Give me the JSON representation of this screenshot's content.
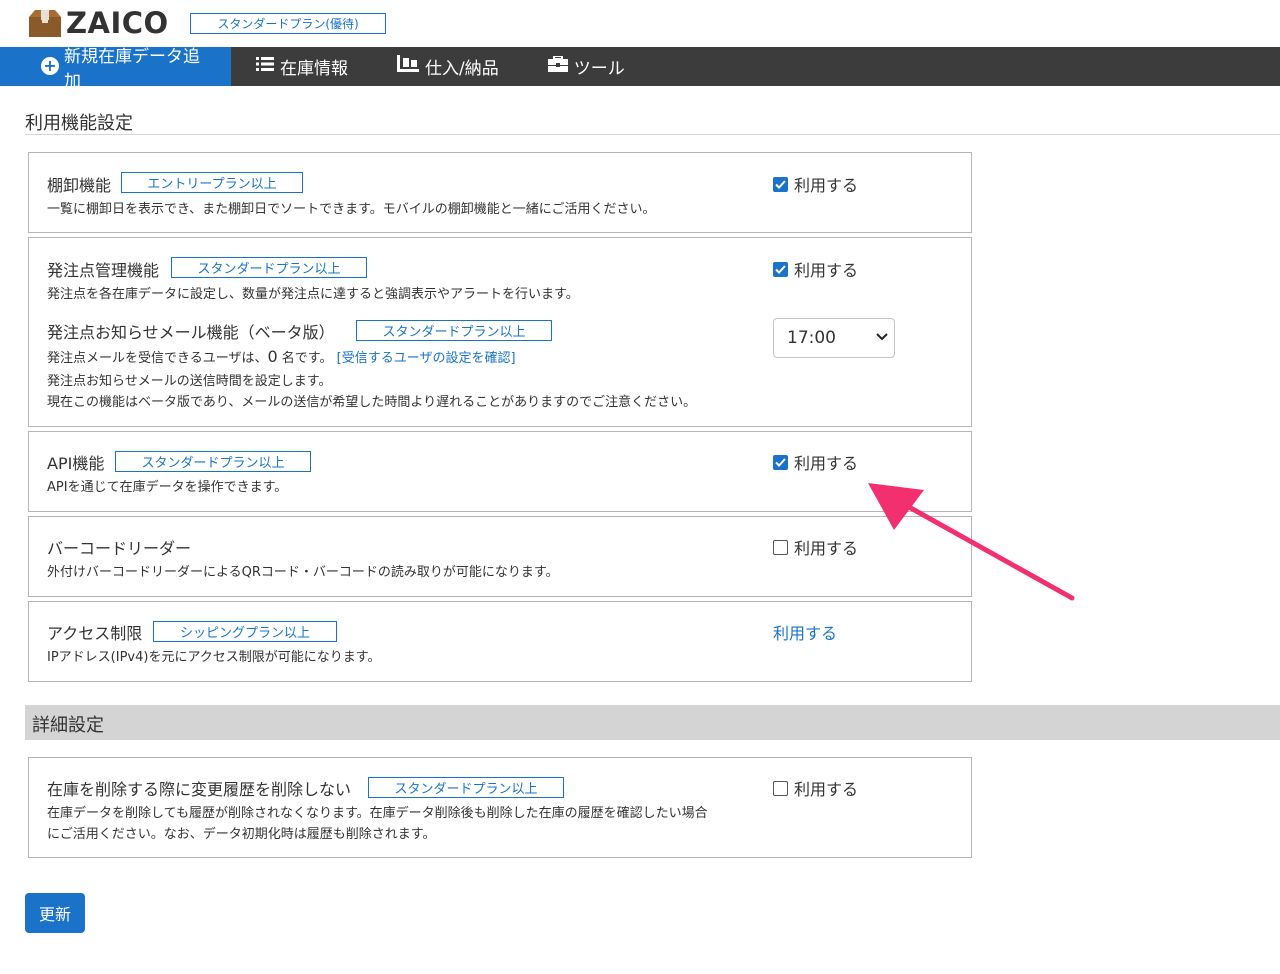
{
  "header": {
    "logo_text": "ZAICO",
    "plan_badge": "スタンダードプラン(優待)"
  },
  "nav": {
    "add_label": "新規在庫データ追加",
    "inventory_label": "在庫情報",
    "purchase_label": "仕入/納品",
    "tools_label": "ツール"
  },
  "usage_section": {
    "title": "利用機能設定"
  },
  "features": {
    "stocktake": {
      "title": "棚卸機能",
      "badge": "エントリープラン以上",
      "desc": "一覧に棚卸日を表示でき、また棚卸日でソートできます。モバイルの棚卸機能と一緒にご活用ください。",
      "check_label": "利用する",
      "checked": true
    },
    "order_point": {
      "title": "発注点管理機能",
      "badge": "スタンダードプラン以上",
      "desc": "発注点を各在庫データに設定し、数量が発注点に達すると強調表示やアラートを行います。",
      "check_label": "利用する",
      "checked": true,
      "mail_title": "発注点お知らせメール機能（ベータ版）",
      "mail_badge": "スタンダードプラン以上",
      "mail_desc1_prefix": "発注点メールを受信できるユーザは、",
      "mail_desc1_count": "0",
      "mail_desc1_suffix": " 名です。",
      "mail_desc1_link": "[受信するユーザの設定を確認]",
      "mail_desc2": "発注点お知らせメールの送信時間を設定します。",
      "mail_desc3": "現在この機能はベータ版であり、メールの送信が希望した時間より遅れることがありますのでご注意ください。",
      "time_value": "17:00"
    },
    "api": {
      "title": "API機能",
      "badge": "スタンダードプラン以上",
      "desc": "APIを通じて在庫データを操作できます。",
      "check_label": "利用する",
      "checked": true
    },
    "barcode": {
      "title": "バーコードリーダー",
      "desc": "外付けバーコードリーダーによるQRコード・バーコードの読み取りが可能になります。",
      "check_label": "利用する",
      "checked": false
    },
    "access": {
      "title": "アクセス制限",
      "badge": "シッピングプラン以上",
      "desc": "IPアドレス(IPv4)を元にアクセス制限が可能になります。",
      "link_label": "利用する"
    }
  },
  "detail_section": {
    "title": "詳細設定"
  },
  "details": {
    "keep_history": {
      "title": "在庫を削除する際に変更履歴を削除しない",
      "badge": "スタンダードプラン以上",
      "desc1": "在庫データを削除しても履歴が削除されなくなります。在庫データ削除後も削除した在庫の履歴を確認したい場合",
      "desc2": "にご活用ください。なお、データ初期化時は履歴も削除されます。",
      "check_label": "利用する",
      "checked": false
    }
  },
  "update_button": "更新",
  "colors": {
    "accent": "#1a73c8",
    "nav_bg": "#3c3c3c",
    "annotation_arrow": "#f2306f"
  }
}
